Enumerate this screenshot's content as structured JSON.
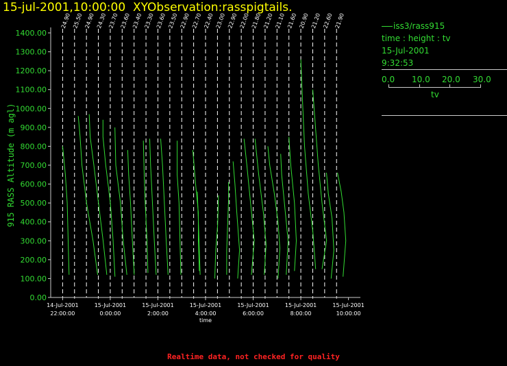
{
  "title": "15-jul-2001,10:00:00  XYObservation:rasspigtails.",
  "legend": {
    "series_label": "iss3/rass915",
    "variables": "time : height : tv",
    "date": "15-Jul-2001",
    "time": "9:32:53",
    "scale_ticks": [
      "0.0",
      "10.0",
      "20.0",
      "30.0"
    ],
    "scale_label": "tv"
  },
  "footer": "Realtime data, not checked for quality",
  "colors": {
    "axis": "#cccccc",
    "series": "#33dd33",
    "title": "#ffff00",
    "warning": "#ff2222",
    "ref": "#ffffff"
  },
  "chart_data": {
    "type": "line",
    "title": "",
    "xlabel": "time",
    "ylabel": "915 RASS Altitude (m agl)",
    "ylim": [
      0,
      1400
    ],
    "y_ticks": [
      "0.00",
      "100.00",
      "200.00",
      "300.00",
      "400.00",
      "500.00",
      "600.00",
      "700.00",
      "800.00",
      "900.00",
      "1000.00",
      "1100.00",
      "1200.00",
      "1300.00",
      "1400.00"
    ],
    "xlim": [
      "14-Jul-2001 21:30",
      "15-Jul-2001 10:30"
    ],
    "x_ticks": [
      {
        "date": "14-Jul-2001",
        "time": "22:00:00"
      },
      {
        "date": "15-Jul-2001",
        "time": "0:00:00"
      },
      {
        "date": "15-Jul-2001",
        "time": "2:00:00"
      },
      {
        "date": "15-Jul-2001",
        "time": "4:00:00"
      },
      {
        "date": "15-Jul-2001",
        "time": "6:00:00"
      },
      {
        "date": "15-Jul-2001",
        "time": "8:00:00"
      },
      {
        "date": "15-Jul-2001",
        "time": "10:00:00"
      }
    ],
    "tv_scale": [
      0,
      30
    ],
    "profiles": [
      {
        "time": "14-Jul-2001 22:00",
        "ref": "24.90",
        "points": [
          [
            120,
            7
          ],
          [
            300,
            6
          ],
          [
            500,
            5
          ],
          [
            650,
            3
          ],
          [
            800,
            0
          ]
        ]
      },
      {
        "time": "14-Jul-2001 22:30",
        "ref": "25.50",
        "points": [
          [
            120,
            25
          ],
          [
            300,
            20
          ],
          [
            500,
            13
          ],
          [
            700,
            8
          ],
          [
            850,
            6
          ],
          [
            960,
            4
          ]
        ]
      },
      {
        "time": "14-Jul-2001 23:00",
        "ref": "24.90",
        "points": [
          [
            120,
            22
          ],
          [
            300,
            18
          ],
          [
            500,
            13
          ],
          [
            700,
            8
          ],
          [
            850,
            4
          ],
          [
            970,
            3
          ]
        ]
      },
      {
        "time": "14-Jul-2001 23:30",
        "ref": "24.30",
        "points": [
          [
            110,
            18
          ],
          [
            300,
            16
          ],
          [
            500,
            13
          ],
          [
            700,
            8
          ],
          [
            850,
            5
          ],
          [
            940,
            5
          ]
        ]
      },
      {
        "time": "15-Jul-2001 00:00",
        "ref": "23.70",
        "points": [
          [
            120,
            18
          ],
          [
            300,
            14
          ],
          [
            500,
            11
          ],
          [
            700,
            6
          ],
          [
            900,
            5
          ]
        ]
      },
      {
        "time": "15-Jul-2001 00:30",
        "ref": "23.60",
        "points": [
          [
            120,
            13
          ],
          [
            300,
            11
          ],
          [
            500,
            9
          ],
          [
            650,
            7
          ],
          [
            780,
            6
          ]
        ]
      },
      {
        "time": "15-Jul-2001 01:00",
        "ref": "23.40",
        "points": [
          [
            130,
            15
          ],
          [
            300,
            14
          ],
          [
            500,
            12
          ],
          [
            650,
            11
          ],
          [
            830,
            10
          ]
        ]
      },
      {
        "time": "15-Jul-2001 01:30",
        "ref": "23.30",
        "points": [
          [
            120,
            11
          ],
          [
            300,
            9
          ],
          [
            500,
            7
          ],
          [
            700,
            5
          ],
          [
            840,
            4
          ]
        ]
      },
      {
        "time": "15-Jul-2001 02:00",
        "ref": "23.60",
        "points": [
          [
            120,
            11
          ],
          [
            300,
            9
          ],
          [
            500,
            7
          ],
          [
            700,
            5
          ],
          [
            840,
            3
          ]
        ]
      },
      {
        "time": "15-Jul-2001 02:30",
        "ref": "23.50",
        "points": [
          [
            120,
            12
          ],
          [
            300,
            11
          ],
          [
            500,
            10
          ],
          [
            650,
            8
          ],
          [
            830,
            8
          ]
        ]
      },
      {
        "time": "15-Jul-2001 03:00",
        "ref": "22.90",
        "points": [
          [
            140,
            19
          ],
          [
            300,
            18
          ],
          [
            450,
            18
          ],
          [
            600,
            15
          ],
          [
            780,
            12
          ]
        ]
      },
      {
        "time": "15-Jul-2001 03:30",
        "ref": "22.70",
        "points": [
          [
            120,
            7
          ],
          [
            280,
            6
          ],
          [
            420,
            5
          ],
          [
            560,
            4
          ]
        ]
      },
      {
        "time": "15-Jul-2001 04:00",
        "ref": "22.40",
        "points": [
          [
            100,
            10
          ],
          [
            250,
            11
          ],
          [
            380,
            13
          ],
          [
            540,
            14
          ]
        ]
      },
      {
        "time": "15-Jul-2001 04:30",
        "ref": "23.00",
        "points": [
          [
            120,
            10
          ],
          [
            250,
            10
          ],
          [
            380,
            11
          ],
          [
            520,
            12
          ],
          [
            610,
            12
          ]
        ]
      },
      {
        "time": "15-Jul-2001 05:00",
        "ref": "22.90",
        "points": [
          [
            100,
            9
          ],
          [
            250,
            11
          ],
          [
            450,
            8
          ],
          [
            600,
            6
          ],
          [
            720,
            4
          ]
        ]
      },
      {
        "time": "15-Jul-2001 05:30",
        "ref": "22.00",
        "points": [
          [
            120,
            11
          ],
          [
            300,
            14
          ],
          [
            500,
            10
          ],
          [
            700,
            6
          ],
          [
            840,
            3
          ]
        ]
      },
      {
        "time": "15-Jul-2001 06:00",
        "ref": "21.80",
        "points": [
          [
            120,
            12
          ],
          [
            280,
            14
          ],
          [
            450,
            11
          ],
          [
            650,
            6
          ],
          [
            840,
            2
          ]
        ]
      },
      {
        "time": "15-Jul-2001 06:30",
        "ref": "21.20",
        "points": [
          [
            100,
            14
          ],
          [
            260,
            16
          ],
          [
            400,
            14
          ],
          [
            550,
            10
          ],
          [
            700,
            5
          ],
          [
            800,
            3
          ]
        ]
      },
      {
        "time": "15-Jul-2001 07:00",
        "ref": "21.10",
        "points": [
          [
            120,
            10
          ],
          [
            300,
            12
          ],
          [
            500,
            8
          ],
          [
            650,
            5
          ],
          [
            760,
            4
          ]
        ]
      },
      {
        "time": "15-Jul-2001 07:30",
        "ref": "21.60",
        "points": [
          [
            140,
            6
          ],
          [
            300,
            8
          ],
          [
            500,
            6
          ],
          [
            700,
            2
          ],
          [
            850,
            0
          ]
        ]
      },
      {
        "time": "15-Jul-2001 08:00",
        "ref": "20.90",
        "points": [
          [
            150,
            16
          ],
          [
            350,
            13
          ],
          [
            550,
            8
          ],
          [
            800,
            4
          ],
          [
            1020,
            2
          ],
          [
            1260,
            0
          ]
        ]
      },
      {
        "time": "15-Jul-2001 08:30",
        "ref": "21.20",
        "points": [
          [
            150,
            10
          ],
          [
            300,
            15
          ],
          [
            500,
            10
          ],
          [
            700,
            6
          ],
          [
            900,
            3
          ],
          [
            1100,
            0
          ]
        ]
      },
      {
        "time": "15-Jul-2001 09:00",
        "ref": "22.60",
        "points": [
          [
            100,
            7
          ],
          [
            250,
            10
          ],
          [
            420,
            8
          ],
          [
            550,
            4
          ],
          [
            660,
            2
          ]
        ]
      },
      {
        "time": "15-Jul-2001 09:30",
        "ref": "21.90",
        "points": [
          [
            110,
            7
          ],
          [
            300,
            10
          ],
          [
            450,
            8
          ],
          [
            560,
            5
          ],
          [
            660,
            1
          ]
        ]
      }
    ]
  }
}
